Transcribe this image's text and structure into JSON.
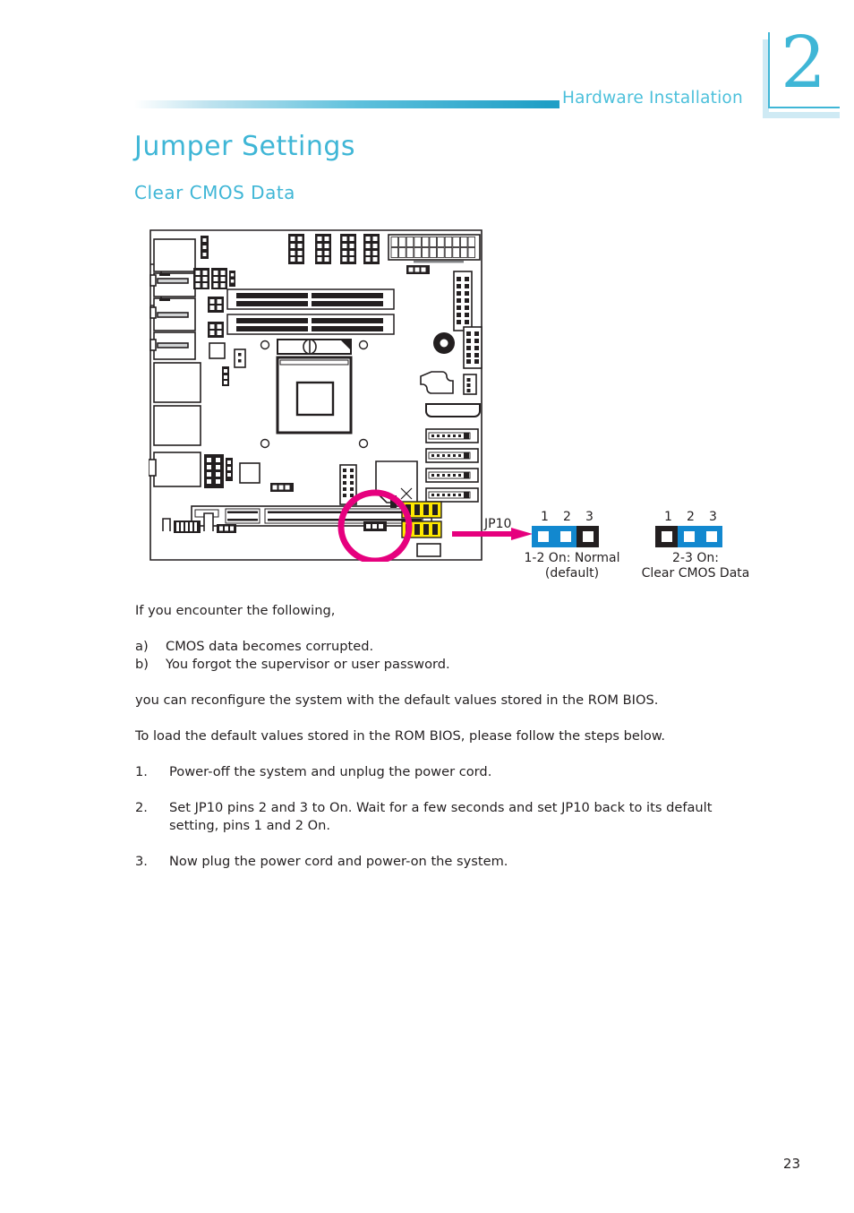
{
  "header": {
    "running_title": "Hardware Installation",
    "chapter_number": "2"
  },
  "headings": {
    "title": "Jumper Settings",
    "subtitle": "Clear CMOS Data"
  },
  "diagram": {
    "jumper_label": "JP10",
    "settings": [
      {
        "pin_numbers": [
          "1",
          "2",
          "3"
        ],
        "pins": [
          "on",
          "on",
          "off"
        ],
        "caption_line1": "1-2 On: Normal",
        "caption_line2": "(default)"
      },
      {
        "pin_numbers": [
          "1",
          "2",
          "3"
        ],
        "pins": [
          "off",
          "on",
          "on"
        ],
        "caption_line1": "2-3 On:",
        "caption_line2": "Clear CMOS Data"
      }
    ]
  },
  "body": {
    "intro": "If you encounter the following,",
    "conditions": [
      {
        "marker": "a)",
        "text": "CMOS data becomes corrupted."
      },
      {
        "marker": "b)",
        "text": "You forgot the supervisor or user password."
      }
    ],
    "para2": "you can reconfigure the system with the default values stored in the ROM BIOS.",
    "para3": "To load the default values stored in the ROM BIOS, please follow the steps below.",
    "steps": [
      {
        "marker": "1.",
        "text": "Power-off the system and unplug the power cord."
      },
      {
        "marker": "2.",
        "text": "Set JP10 pins 2 and 3 to On. Wait for a few seconds and set JP10 back to its default setting, pins 1 and 2 On."
      },
      {
        "marker": "3.",
        "text": "Now plug the power cord and power-on the system."
      }
    ]
  },
  "footer": {
    "page_number": "23"
  },
  "colors": {
    "accent_cyan": "#3fb6d6",
    "header_cyan": "#4cc0db",
    "jumper_blue": "#1288cf",
    "highlight_magenta": "#e6007e",
    "header_yellow": "#ffe800",
    "ink": "#231f20"
  }
}
